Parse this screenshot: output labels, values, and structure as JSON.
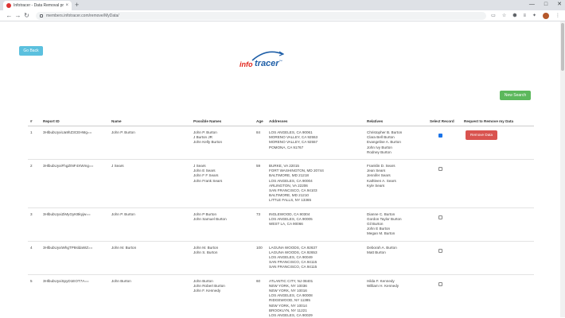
{
  "browser": {
    "tab_title": "Infotracer - Data Removal proc...",
    "tab_close": "×",
    "new_tab": "+",
    "window_controls": [
      "—",
      "□",
      "✕"
    ],
    "url": "members.infotracer.com/remove/MyData/"
  },
  "page": {
    "go_back_label": "Go Back",
    "new_search_label": "New Search",
    "logo": {
      "part1": "info",
      "part2": "tracer",
      "tm": "™"
    }
  },
  "table": {
    "headers": [
      "#",
      "Report ID",
      "Name",
      "Possible Names",
      "Age",
      "Addresses",
      "Relatives",
      "Select Record",
      "Request to Remove my Data"
    ],
    "remove_label": "Remove Data",
    "rows": [
      {
        "num": "1",
        "report_id": "3HlbubUyxiUa9hZ3CEHMg==",
        "name": "John P. Burton",
        "possible_names": [
          "John P. Burton",
          "J Burton JR",
          "John Kelly Burton"
        ],
        "age": "84",
        "addresses": [
          "LOS ANGELES, CA 90061",
          "MORENO VALLEY, CA 92553",
          "MORENO VALLEY, CA 92557",
          "POMONA, CA 91767"
        ],
        "relatives": [
          "Christopher B. Burton",
          "Clara Bell Burton",
          "Evangeline A. Burton",
          "John Ivy Burton",
          "Rodney Burton"
        ],
        "selected": true,
        "show_remove": true
      },
      {
        "num": "2",
        "report_id": "3HlbubUyxiFhgZtNF4XWmg==",
        "name": "J Sears",
        "possible_names": [
          "J Sears",
          "John E Sears",
          "John F F Sears",
          "John Frank Sears"
        ],
        "age": "59",
        "addresses": [
          "BURKE, VA 22015",
          "FORT WASHINGTON, MD 20744",
          "BALTIMORE, MD 21218",
          "LOS ANGELES, CA 90004",
          "ARLINGTON, VA 22206",
          "SAN FRANCISCO, CA 94103",
          "BALTIMORE, MD 21210",
          "LITTLE FALLS, NY 13365"
        ],
        "relatives": [
          "Franklin D. Sears",
          "Jean Sears",
          "Jennifer Sears",
          "Kathleen A. Sears",
          "Kyle Sears"
        ],
        "selected": false,
        "show_remove": false
      },
      {
        "num": "3",
        "report_id": "3HlbubUyxiZiMyGyKBkyjw==",
        "name": "John P. Burton",
        "possible_names": [
          "John P Burton",
          "John Samuel Burton"
        ],
        "age": "73",
        "addresses": [
          "INGLEWOOD, CA 90304",
          "LOS ANGELES, CA 90005",
          "WEST LA, CA 90066"
        ],
        "relatives": [
          "Dianne C. Burton",
          "Gordon Taylor Burton",
          "Gil Burton",
          "John E Burton",
          "Megan M. Burton"
        ],
        "selected": false,
        "show_remove": false
      },
      {
        "num": "4",
        "report_id": "3HlbubUyxiWhgTP8sldaWZ==",
        "name": "John M. Burton",
        "possible_names": [
          "John M. Burton",
          "John S. Burton"
        ],
        "age": "100",
        "addresses": [
          "LAGUNA WOODS, CA 92637",
          "LAGUNA WOODS, CA 92653",
          "LOS ANGELES, CA 90049",
          "SAN FRANCISCO, CA 94115",
          "SAN FRANCISCO, CA 94115"
        ],
        "relatives": [
          "Deborah A. Burton",
          "Matt Burton"
        ],
        "selected": false,
        "show_remove": false
      },
      {
        "num": "5",
        "report_id": "3HlbubUyxiSpyD1EOT7A==",
        "name": "John Burton",
        "possible_names": [
          "John Burton",
          "John Robert Burton",
          "John F. Kennedy"
        ],
        "age": "60",
        "addresses": [
          "ATLANTIC CITY, NJ 08401",
          "NEW YORK, NY 10036",
          "NEW YORK, NY 10016",
          "LOS ANGELES, CA 90008",
          "RIDGEWOOD, NY 11385",
          "NEW YORK, NY 10014",
          "BROOKLYN, NY 11221",
          "LOS ANGELES, CA 90029",
          "LOS ANGELES, CA 90008"
        ],
        "relatives": [
          "Hilda F. Kennedy",
          "William H. Kennedy"
        ],
        "selected": false,
        "show_remove": false
      }
    ]
  }
}
